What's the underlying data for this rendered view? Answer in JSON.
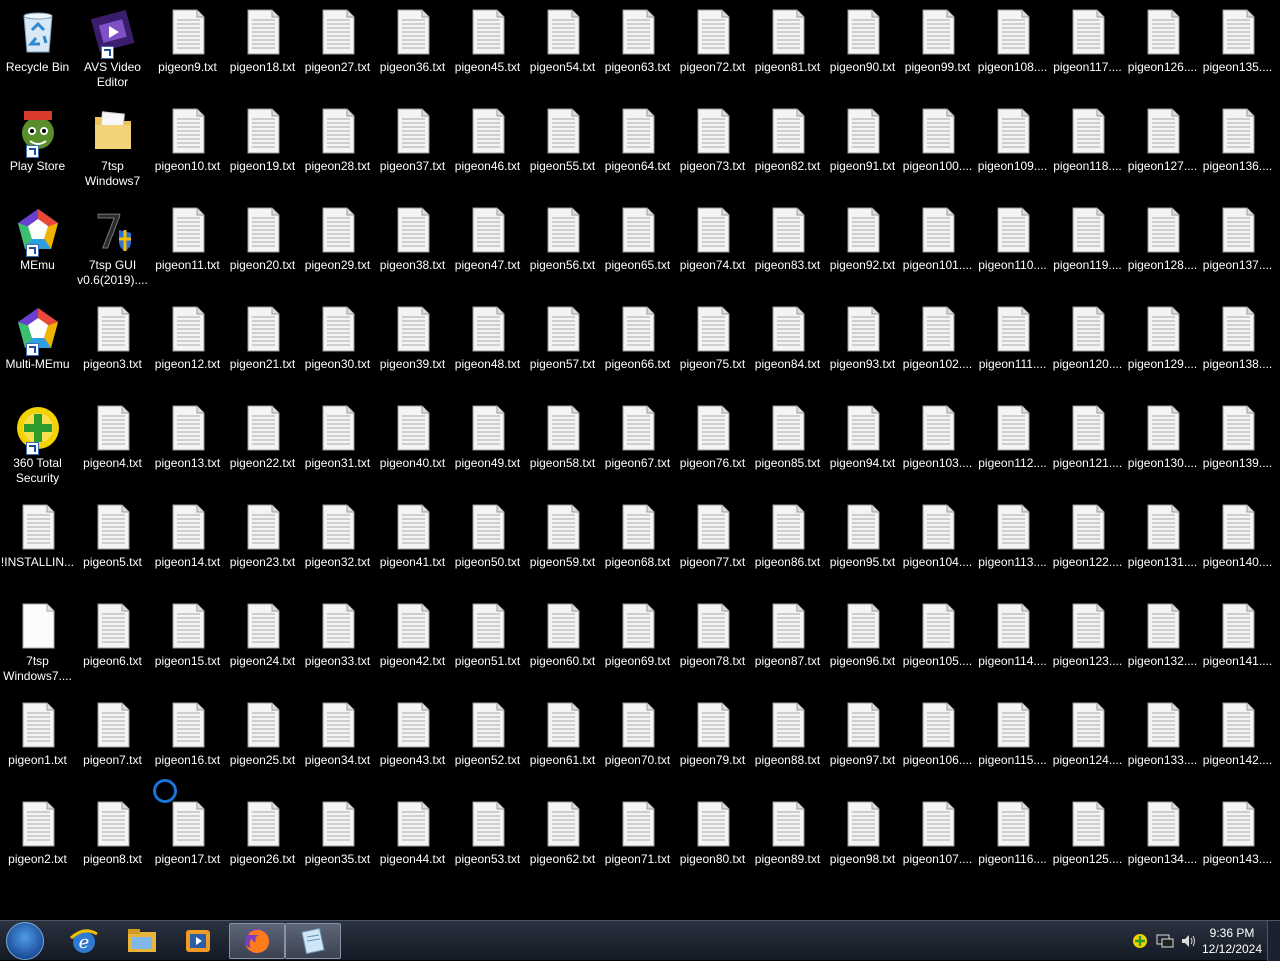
{
  "desktop": {
    "columns": [
      [
        {
          "label": "Recycle Bin",
          "icon": "recycle-bin-icon",
          "type": "recycle"
        },
        {
          "label": "Play Store",
          "icon": "play-store-icon",
          "type": "game",
          "shortcut": true
        },
        {
          "label": "MEmu",
          "icon": "memu-icon",
          "type": "memu",
          "shortcut": true
        },
        {
          "label": "Multi-MEmu",
          "icon": "multi-memu-icon",
          "type": "memu",
          "shortcut": true
        },
        {
          "label": "360 Total\nSecurity",
          "icon": "360-security-icon",
          "type": "security",
          "shortcut": true
        },
        {
          "label": "!INSTALLIN...",
          "icon": "text-file-icon",
          "type": "txt"
        },
        {
          "label": "7tsp\nWindows7....",
          "icon": "blank-file-icon",
          "type": "blank"
        },
        {
          "label": "pigeon1.txt",
          "icon": "text-file-icon",
          "type": "txt"
        },
        {
          "label": "pigeon2.txt",
          "icon": "text-file-icon",
          "type": "txt"
        }
      ],
      [
        {
          "label": "AVS Video\nEditor",
          "icon": "avs-video-editor-icon",
          "type": "film",
          "shortcut": true
        },
        {
          "label": "7tsp\nWindows7",
          "icon": "folder-icon",
          "type": "folder"
        },
        {
          "label": "7tsp GUI\nv0.6(2019)....",
          "icon": "7tsp-gui-icon",
          "type": "seven",
          "shortcut": false
        },
        {
          "label": "pigeon3.txt",
          "icon": "text-file-icon",
          "type": "txt"
        },
        {
          "label": "pigeon4.txt",
          "icon": "text-file-icon",
          "type": "txt"
        },
        {
          "label": "pigeon5.txt",
          "icon": "text-file-icon",
          "type": "txt"
        },
        {
          "label": "pigeon6.txt",
          "icon": "text-file-icon",
          "type": "txt"
        },
        {
          "label": "pigeon7.txt",
          "icon": "text-file-icon",
          "type": "txt"
        },
        {
          "label": "pigeon8.txt",
          "icon": "text-file-icon",
          "type": "txt"
        }
      ],
      [
        "pigeon9.txt",
        "pigeon10.txt",
        "pigeon11.txt",
        "pigeon12.txt",
        "pigeon13.txt",
        "pigeon14.txt",
        "pigeon15.txt",
        "pigeon16.txt",
        "pigeon17.txt"
      ],
      [
        "pigeon18.txt",
        "pigeon19.txt",
        "pigeon20.txt",
        "pigeon21.txt",
        "pigeon22.txt",
        "pigeon23.txt",
        "pigeon24.txt",
        "pigeon25.txt",
        "pigeon26.txt"
      ],
      [
        "pigeon27.txt",
        "pigeon28.txt",
        "pigeon29.txt",
        "pigeon30.txt",
        "pigeon31.txt",
        "pigeon32.txt",
        "pigeon33.txt",
        "pigeon34.txt",
        "pigeon35.txt"
      ],
      [
        "pigeon36.txt",
        "pigeon37.txt",
        "pigeon38.txt",
        "pigeon39.txt",
        "pigeon40.txt",
        "pigeon41.txt",
        "pigeon42.txt",
        "pigeon43.txt",
        "pigeon44.txt"
      ],
      [
        "pigeon45.txt",
        "pigeon46.txt",
        "pigeon47.txt",
        "pigeon48.txt",
        "pigeon49.txt",
        "pigeon50.txt",
        "pigeon51.txt",
        "pigeon52.txt",
        "pigeon53.txt"
      ],
      [
        "pigeon54.txt",
        "pigeon55.txt",
        "pigeon56.txt",
        "pigeon57.txt",
        "pigeon58.txt",
        "pigeon59.txt",
        "pigeon60.txt",
        "pigeon61.txt",
        "pigeon62.txt"
      ],
      [
        "pigeon63.txt",
        "pigeon64.txt",
        "pigeon65.txt",
        "pigeon66.txt",
        "pigeon67.txt",
        "pigeon68.txt",
        "pigeon69.txt",
        "pigeon70.txt",
        "pigeon71.txt"
      ],
      [
        "pigeon72.txt",
        "pigeon73.txt",
        "pigeon74.txt",
        "pigeon75.txt",
        "pigeon76.txt",
        "pigeon77.txt",
        "pigeon78.txt",
        "pigeon79.txt",
        "pigeon80.txt"
      ],
      [
        "pigeon81.txt",
        "pigeon82.txt",
        "pigeon83.txt",
        "pigeon84.txt",
        "pigeon85.txt",
        "pigeon86.txt",
        "pigeon87.txt",
        "pigeon88.txt",
        "pigeon89.txt"
      ],
      [
        "pigeon90.txt",
        "pigeon91.txt",
        "pigeon92.txt",
        "pigeon93.txt",
        "pigeon94.txt",
        "pigeon95.txt",
        "pigeon96.txt",
        "pigeon97.txt",
        "pigeon98.txt"
      ],
      [
        "pigeon99.txt",
        "pigeon100....",
        "pigeon101....",
        "pigeon102....",
        "pigeon103....",
        "pigeon104....",
        "pigeon105....",
        "pigeon106....",
        "pigeon107...."
      ],
      [
        "pigeon108....",
        "pigeon109....",
        "pigeon110....",
        "pigeon111....",
        "pigeon112....",
        "pigeon113....",
        "pigeon114....",
        "pigeon115....",
        "pigeon116...."
      ],
      [
        "pigeon117....",
        "pigeon118....",
        "pigeon119....",
        "pigeon120....",
        "pigeon121....",
        "pigeon122....",
        "pigeon123....",
        "pigeon124....",
        "pigeon125...."
      ],
      [
        "pigeon126....",
        "pigeon127....",
        "pigeon128....",
        "pigeon129....",
        "pigeon130....",
        "pigeon131....",
        "pigeon132....",
        "pigeon133....",
        "pigeon134...."
      ],
      [
        "pigeon135....",
        "pigeon136....",
        "pigeon137....",
        "pigeon138....",
        "pigeon139....",
        "pigeon140....",
        "pigeon141....",
        "pigeon142....",
        "pigeon143...."
      ]
    ]
  },
  "taskbar": {
    "start_icon": "windows-start-icon",
    "pinned": [
      {
        "name": "internet-explorer-icon",
        "active": false
      },
      {
        "name": "file-explorer-icon",
        "active": false
      },
      {
        "name": "media-player-icon",
        "active": false
      },
      {
        "name": "firefox-icon",
        "active": true
      },
      {
        "name": "notepad-icon",
        "active": true
      }
    ],
    "tray": {
      "icons": [
        "360-security-tray-icon",
        "network-icon",
        "volume-icon"
      ],
      "time": "9:36 PM",
      "date": "12/12/2024"
    }
  },
  "colors": {
    "desktop": "#000000",
    "busy_cursor": "#1a73d9"
  }
}
